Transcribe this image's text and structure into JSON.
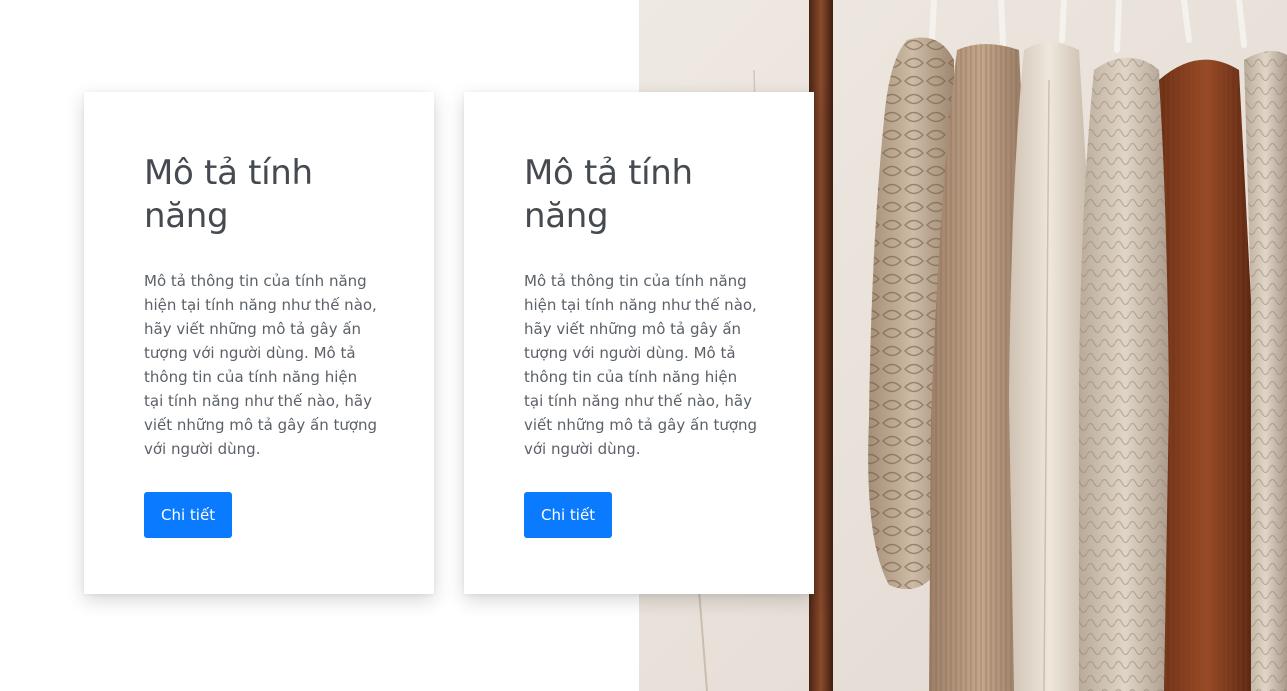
{
  "cards": [
    {
      "title": "Mô tả tính năng",
      "text": "Mô tả thông tin của tính năng hiện tại tính năng như thế nào, hãy viết những mô tả gây ấn tượng với người dùng. Mô tả thông tin của tính năng hiện tại tính năng như thế nào, hãy viết những mô tả gây ấn tượng với người dùng.",
      "button_label": "Chi tiết"
    },
    {
      "title": "Mô tả tính năng",
      "text": "Mô tả thông tin của tính năng hiện tại tính năng như thế nào, hãy viết những mô tả gây ấn tượng với người dùng. Mô tả thông tin của tính năng hiện tại tính năng như thế nào, hãy viết những mô tả gây ấn tượng với người dùng.",
      "button_label": "Chi tiết"
    }
  ],
  "photo": {
    "subject": "clothing-rack-image"
  },
  "colors": {
    "button": "#0a7bff",
    "title": "#444a50",
    "text": "#5b6168"
  }
}
